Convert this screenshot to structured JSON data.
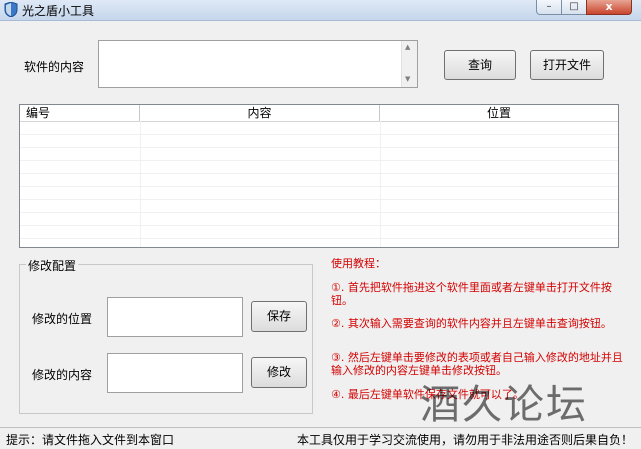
{
  "window": {
    "title": "光之盾小工具",
    "controls": {
      "minimize": "–",
      "maximize": "□",
      "close": "x"
    }
  },
  "search": {
    "label": "软件的内容",
    "value": "",
    "query_button": "查询",
    "open_button": "打开文件"
  },
  "list": {
    "columns": [
      "编号",
      "内容",
      "位置"
    ]
  },
  "modify": {
    "group_title": "修改配置",
    "position_label": "修改的位置",
    "position_value": "",
    "save_button": "保存",
    "content_label": "修改的内容",
    "content_value": "",
    "modify_button": "修改"
  },
  "tutorial": {
    "title": "使用教程：",
    "steps": [
      "①. 首先把软件拖进这个软件里面或者左键单击打开文件按钮。",
      "②. 其次输入需要查询的软件内容并且左键单击查询按钮。",
      "③. 然后左键单击要修改的表项或者自己输入修改的地址并且输入修改的内容左键单击修改按钮。",
      "④. 最后左键单软件保存文件就可以了。"
    ]
  },
  "status": {
    "left": "提示：请文件拖入文件到本窗口",
    "right": "本工具仅用于学习交流使用，请勿用于非法用途否则后果自负！"
  },
  "watermark": "酒久论坛",
  "colors": {
    "tutorial_text": "#d40000",
    "window_bg": "#f0f0f0",
    "close_button": "#c9452d"
  }
}
